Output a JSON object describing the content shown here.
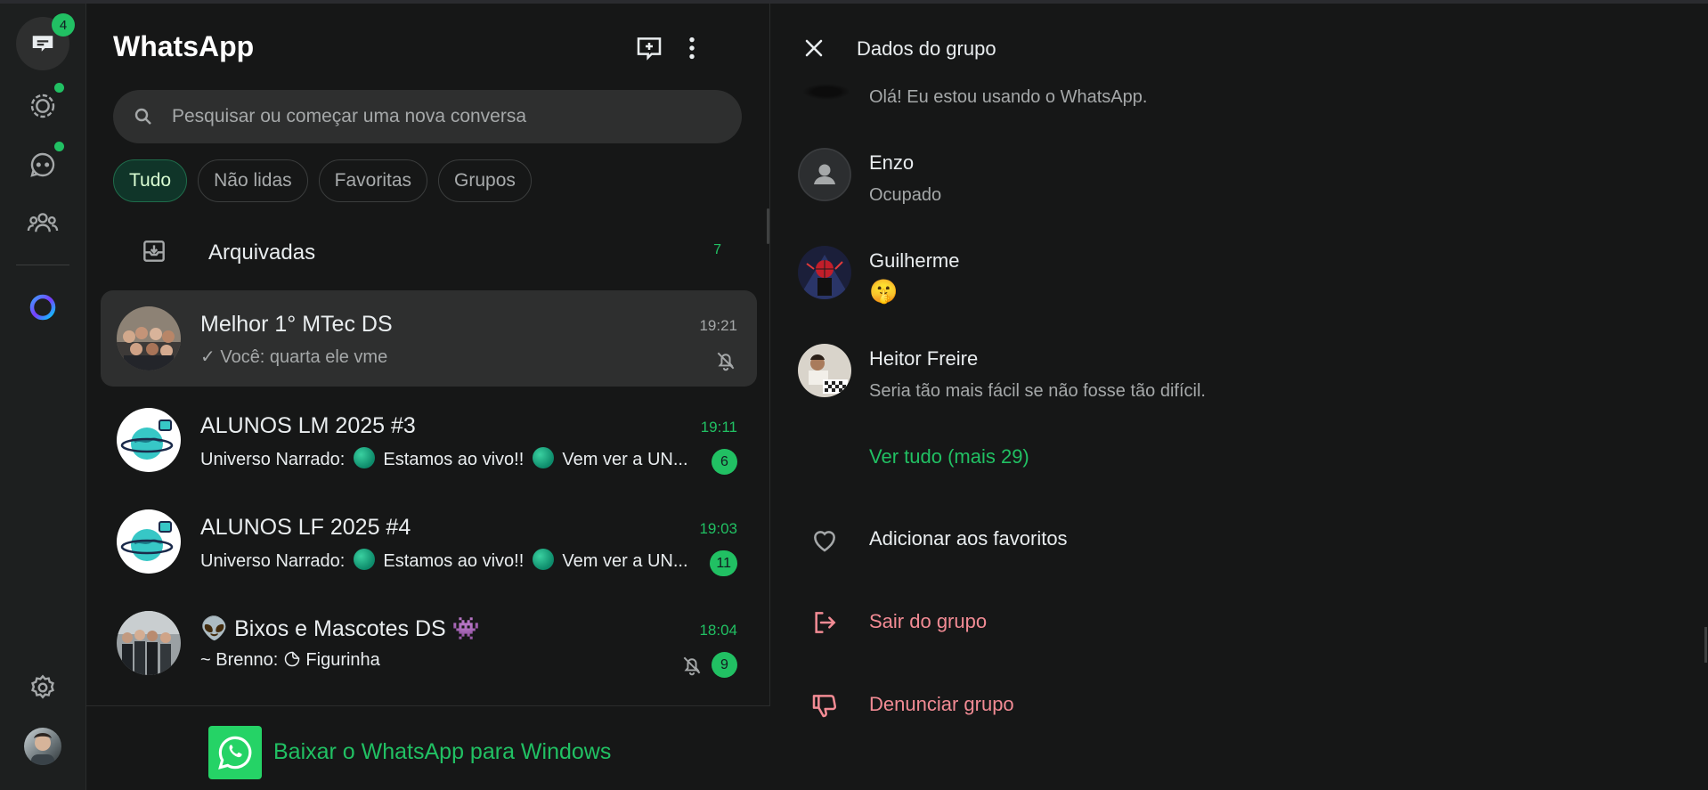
{
  "colors": {
    "accent_green": "#21c063",
    "danger_red": "#f28b94",
    "panel_bg": "#161717",
    "selected_row_bg": "#2e2f2f"
  },
  "rail": {
    "items": [
      {
        "name": "chats",
        "icon": "chats-icon",
        "badge": "4"
      },
      {
        "name": "status",
        "icon": "status-icon",
        "dot": true
      },
      {
        "name": "channels",
        "icon": "channels-icon",
        "dot": true
      },
      {
        "name": "communities",
        "icon": "communities-icon"
      },
      {
        "name": "meta-ai",
        "icon": "meta-ai-icon"
      }
    ],
    "settings_icon": "gear-icon"
  },
  "header": {
    "title": "WhatsApp",
    "new_chat_icon": "new-chat-icon",
    "menu_icon": "kebab-menu-icon"
  },
  "search": {
    "placeholder": "Pesquisar ou começar uma nova conversa",
    "value": ""
  },
  "filters": [
    {
      "label": "Tudo",
      "active": true
    },
    {
      "label": "Não lidas",
      "active": false
    },
    {
      "label": "Favoritas",
      "active": false
    },
    {
      "label": "Grupos",
      "active": false
    }
  ],
  "archived": {
    "label": "Arquivadas",
    "count": "7"
  },
  "chats": [
    {
      "name": "Melhor 1° MTec DS",
      "time": "19:21",
      "check": "✓",
      "preview": "Você: quarta ele vme",
      "muted": true,
      "unread": "",
      "selected": true
    },
    {
      "name": "ALUNOS LM 2025 #3",
      "time": "19:11",
      "sender": "Universo Narrado:",
      "preview_a": "Estamos ao vivo!!",
      "preview_b": "Vem ver a UN...",
      "muted": false,
      "unread": "6"
    },
    {
      "name": "ALUNOS LF 2025 #4",
      "time": "19:03",
      "sender": "Universo Narrado:",
      "preview_a": "Estamos ao vivo!!",
      "preview_b": "Vem ver a UN...",
      "muted": false,
      "unread": "11"
    },
    {
      "name_emoji_left": "👽",
      "name": "Bixos e Mascotes DS",
      "name_emoji_right": "👾",
      "time": "18:04",
      "sender": "~ Brenno:",
      "preview": "Figurinha",
      "muted": true,
      "unread": "9"
    }
  ],
  "download": {
    "label": "Baixar o WhatsApp para Windows"
  },
  "details": {
    "title": "Dados do grupo",
    "top_status": "Olá! Eu estou usando o WhatsApp.",
    "members": [
      {
        "name": "Enzo",
        "status": "Ocupado"
      },
      {
        "name": "Guilherme",
        "status": "🤫"
      },
      {
        "name": "Heitor Freire",
        "status": "Seria tão mais fácil se não fosse tão difícil."
      }
    ],
    "see_all": "Ver tudo (mais 29)",
    "actions": [
      {
        "label": "Adicionar aos favoritos",
        "icon": "heart-icon",
        "danger": false
      },
      {
        "label": "Sair do grupo",
        "icon": "exit-icon",
        "danger": true
      },
      {
        "label": "Denunciar grupo",
        "icon": "thumbs-down-icon",
        "danger": true
      }
    ]
  }
}
